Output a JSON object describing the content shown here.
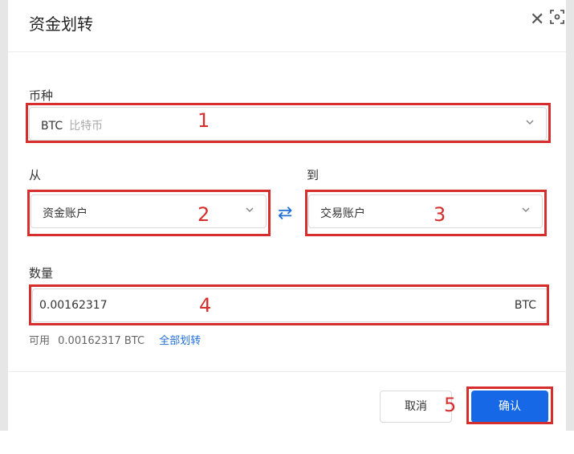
{
  "dialog": {
    "title": "资金划转"
  },
  "currency": {
    "label": "币种",
    "code": "BTC",
    "name": "比特币"
  },
  "from": {
    "label": "从",
    "value": "资金账户"
  },
  "to": {
    "label": "到",
    "value": "交易账户"
  },
  "amount": {
    "label": "数量",
    "value": "0.00162317",
    "unit": "BTC"
  },
  "available": {
    "label": "可用",
    "value": "0.00162317 BTC",
    "transfer_all": "全部划转"
  },
  "buttons": {
    "cancel": "取消",
    "confirm": "确认"
  },
  "annotations": [
    "1",
    "2",
    "3",
    "4",
    "5"
  ],
  "colors": {
    "accent": "#1768e6",
    "annotation": "#d62d2d"
  }
}
